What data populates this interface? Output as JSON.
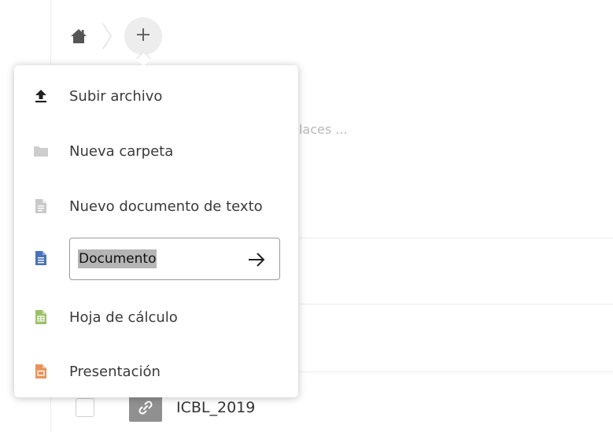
{
  "breadcrumb": {
    "home_icon": "home-icon",
    "separator_icon": "chevron-right-icon",
    "add_icon": "plus-icon"
  },
  "background": {
    "partial_text": "enlaces ...",
    "file_row": {
      "name": "ICBL_2019",
      "thumb_icon": "link-icon"
    }
  },
  "menu": {
    "upload": {
      "label": "Subir archivo",
      "icon": "upload-icon"
    },
    "folder": {
      "label": "Nueva carpeta",
      "icon": "folder-icon"
    },
    "text_doc": {
      "label": "Nuevo documento de texto",
      "icon": "text-file-icon"
    },
    "document": {
      "input_value": "Documento",
      "icon": "document-icon",
      "submit_icon": "arrow-right-icon"
    },
    "spreadsheet": {
      "label": "Hoja de cálculo",
      "icon": "spreadsheet-icon"
    },
    "presentation": {
      "label": "Presentación",
      "icon": "presentation-icon"
    }
  },
  "colors": {
    "document_blue": "#4a72b8",
    "spreadsheet_green": "#9cc06a",
    "presentation_orange": "#e9925a",
    "icon_gray": "#c9c9c9",
    "upload_dark": "#222222"
  }
}
